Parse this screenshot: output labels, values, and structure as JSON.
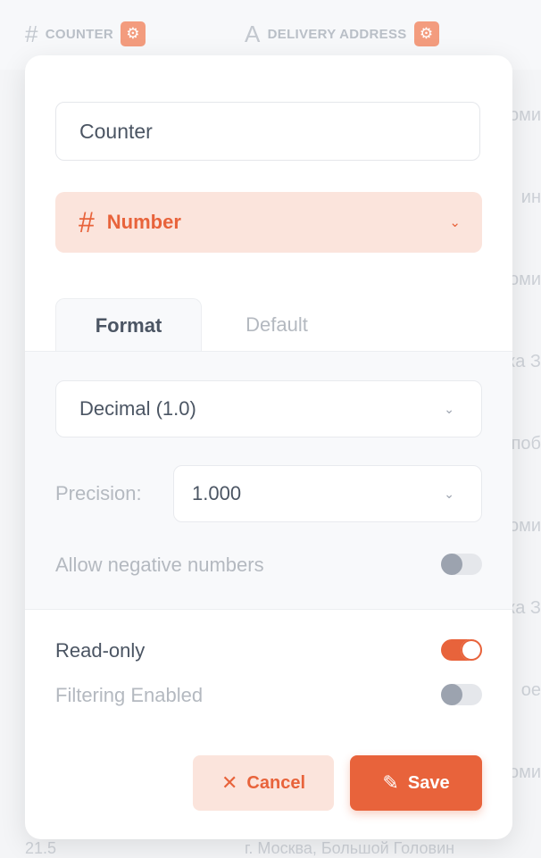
{
  "columns": [
    {
      "type_icon": "#",
      "label": "COUNTER"
    },
    {
      "type_icon": "A",
      "label": "DELIVERY ADDRESS"
    }
  ],
  "background_cells": [
    "оми",
    "ин",
    "оми",
    "ка З",
    "поб",
    "оми",
    "ка З",
    "ое",
    "оми"
  ],
  "background_bottom": {
    "left": "21.5",
    "right": "г. Москва, Большой Головин"
  },
  "modal": {
    "name_value": "Counter",
    "type": {
      "icon": "#",
      "label": "Number"
    },
    "tabs": [
      "Format",
      "Default"
    ],
    "format_value": "Decimal (1.0)",
    "precision_label": "Precision:",
    "precision_value": "1.000",
    "allow_negative_label": "Allow negative numbers",
    "read_only_label": "Read-only",
    "filtering_label": "Filtering Enabled",
    "cancel_label": "Cancel",
    "save_label": "Save"
  },
  "toggles": {
    "allow_negative": false,
    "read_only": true,
    "filtering": false
  },
  "colors": {
    "accent": "#e8633b",
    "accent_soft": "#fbe4dc"
  }
}
